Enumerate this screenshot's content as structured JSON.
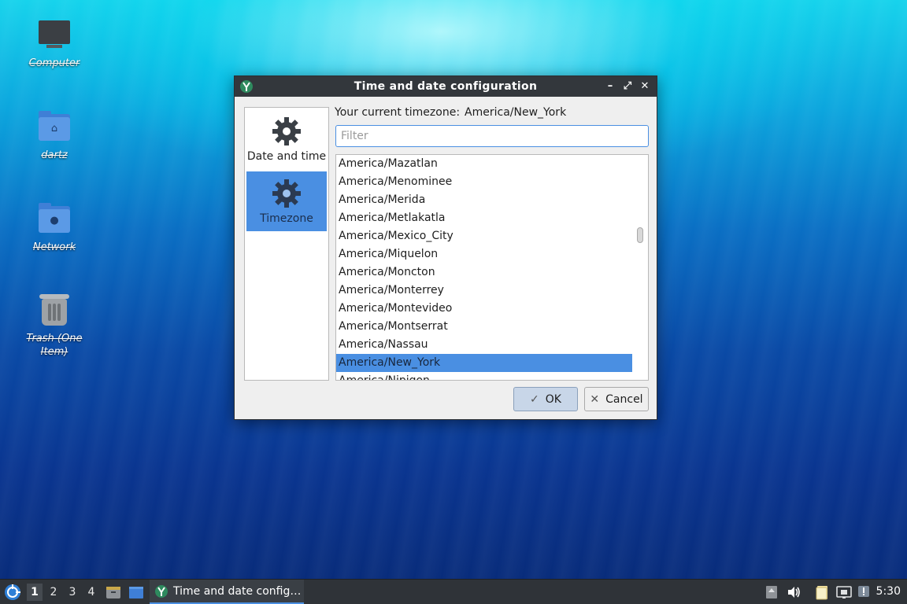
{
  "desktop": {
    "icons": [
      {
        "label": "Computer",
        "icon": "computer-icon"
      },
      {
        "label": "dartz",
        "icon": "home-folder-icon"
      },
      {
        "label": "Network",
        "icon": "network-folder-icon"
      },
      {
        "label": "Trash (One Item)",
        "icon": "trash-icon"
      }
    ]
  },
  "dialog": {
    "title": "Time and date configuration",
    "titlebar_buttons": [
      "–",
      "⤢",
      "✕"
    ],
    "sidebar": {
      "items": [
        {
          "label": "Date and time",
          "icon": "gear-icon",
          "selected": false
        },
        {
          "label": "Timezone",
          "icon": "gear-icon",
          "selected": true
        }
      ]
    },
    "current_label": "Your current timezone:",
    "current_value": "America/New_York",
    "filter_placeholder": "Filter",
    "filter_value": "",
    "timezones": [
      "America/Mazatlan",
      "America/Menominee",
      "America/Merida",
      "America/Metlakatla",
      "America/Mexico_City",
      "America/Miquelon",
      "America/Moncton",
      "America/Monterrey",
      "America/Montevideo",
      "America/Montserrat",
      "America/Nassau",
      "America/New_York",
      "America/Nipigon"
    ],
    "selected_timezone": "America/New_York",
    "ok_label": "OK",
    "cancel_label": "Cancel"
  },
  "taskbar": {
    "workspaces": [
      "1",
      "2",
      "3",
      "4"
    ],
    "active_workspace": "1",
    "task_label": "Time and date config…",
    "clock": "5:30"
  },
  "colors": {
    "accent": "#4a8fe2",
    "titlebar": "#33373c",
    "taskbar": "#2f3338"
  }
}
